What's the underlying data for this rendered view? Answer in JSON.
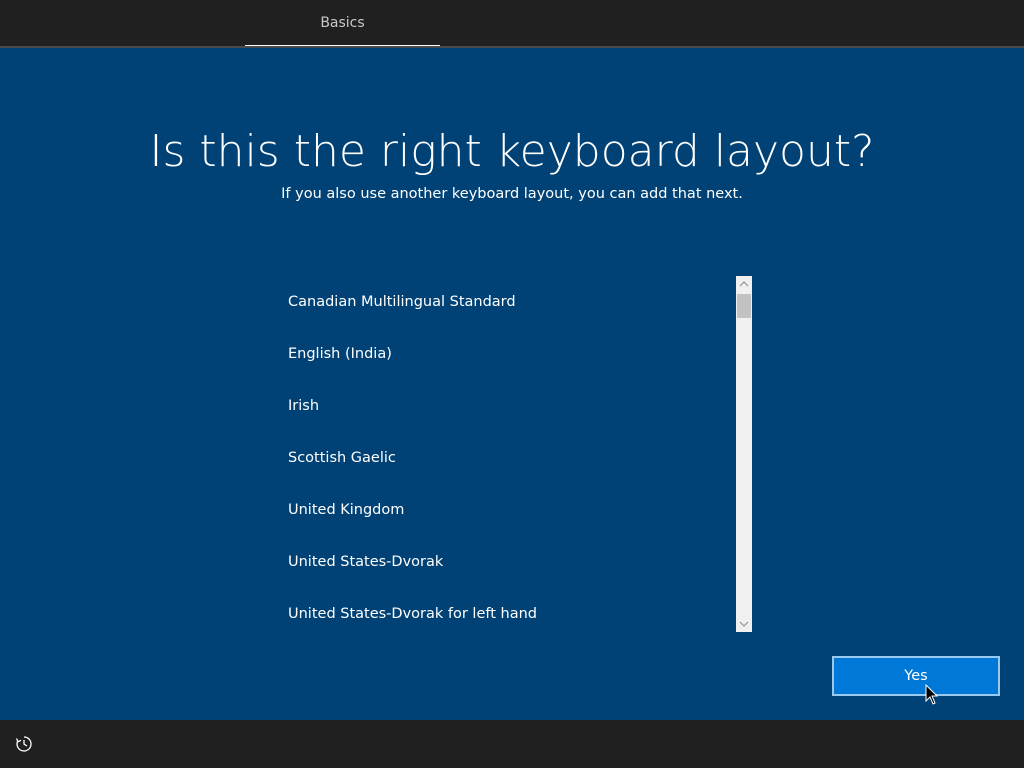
{
  "header": {
    "tab_label": "Basics"
  },
  "main": {
    "title": "Is this the right keyboard layout?",
    "subtitle": "If you also use another keyboard layout, you can add that next."
  },
  "keyboard_list": {
    "items": [
      "Canadian Multilingual Standard",
      "English (India)",
      "Irish",
      "Scottish Gaelic",
      "United Kingdom",
      "United States-Dvorak",
      "United States-Dvorak for left hand"
    ]
  },
  "actions": {
    "yes_label": "Yes"
  },
  "footer": {
    "icon": "accessibility-icon"
  },
  "colors": {
    "background": "#004275",
    "bar": "#202020",
    "accent_button": "#0078d7",
    "button_border": "#99c9ef"
  }
}
